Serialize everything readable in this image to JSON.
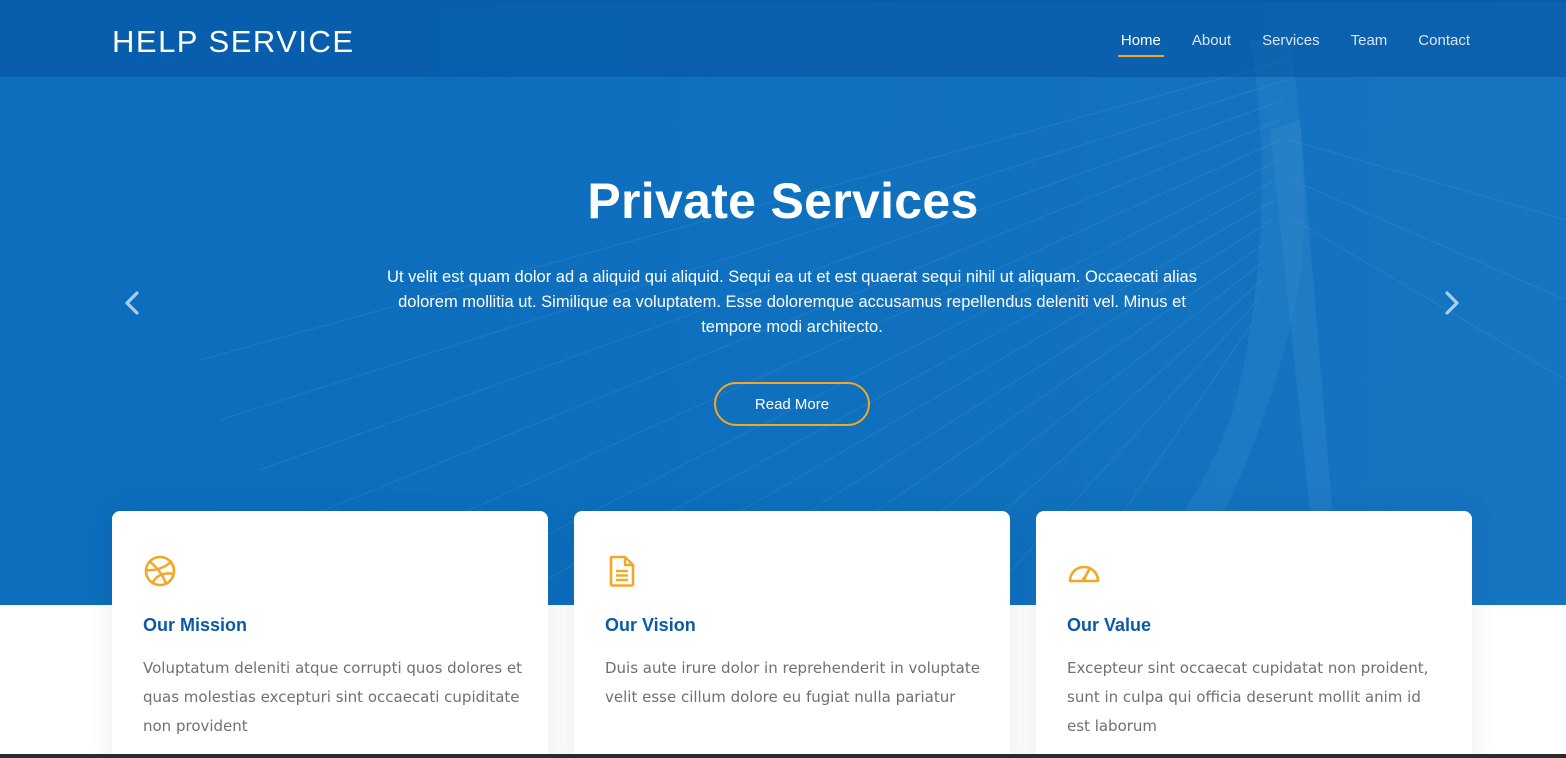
{
  "brand": "HELP SERVICE",
  "nav": [
    {
      "label": "Home",
      "active": true
    },
    {
      "label": "About"
    },
    {
      "label": "Services"
    },
    {
      "label": "Team"
    },
    {
      "label": "Contact"
    }
  ],
  "hero": {
    "title": "Private Services",
    "text": "Ut velit est quam dolor ad a aliquid qui aliquid. Sequi ea ut et est quaerat sequi nihil ut aliquam. Occaecati alias dolorem mollitia ut. Similique ea voluptatem. Esse doloremque accusamus repellendus deleniti vel. Minus et tempore modi architecto.",
    "button": "Read More",
    "prev_icon": "chevron-left-icon",
    "next_icon": "chevron-right-icon"
  },
  "cards": [
    {
      "icon": "dribbble-icon",
      "title": "Our Mission",
      "text": "Voluptatum deleniti atque corrupti quos dolores et quas molestias excepturi sint occaecati cupiditate non provident"
    },
    {
      "icon": "file-text-icon",
      "title": "Our Vision",
      "text": "Duis aute irure dolor in reprehenderit in voluptate velit esse cillum dolore eu fugiat nulla pariatur"
    },
    {
      "icon": "speedometer-icon",
      "title": "Our Value",
      "text": "Excepteur sint occaecat cupidatat non proident, sunt in culpa qui officia deserunt mollit anim id est laborum"
    }
  ],
  "colors": {
    "hero_bg": "#0c6ebd",
    "accent": "#f5a623",
    "card_title": "#0b5aa6",
    "body_text": "#707070"
  }
}
